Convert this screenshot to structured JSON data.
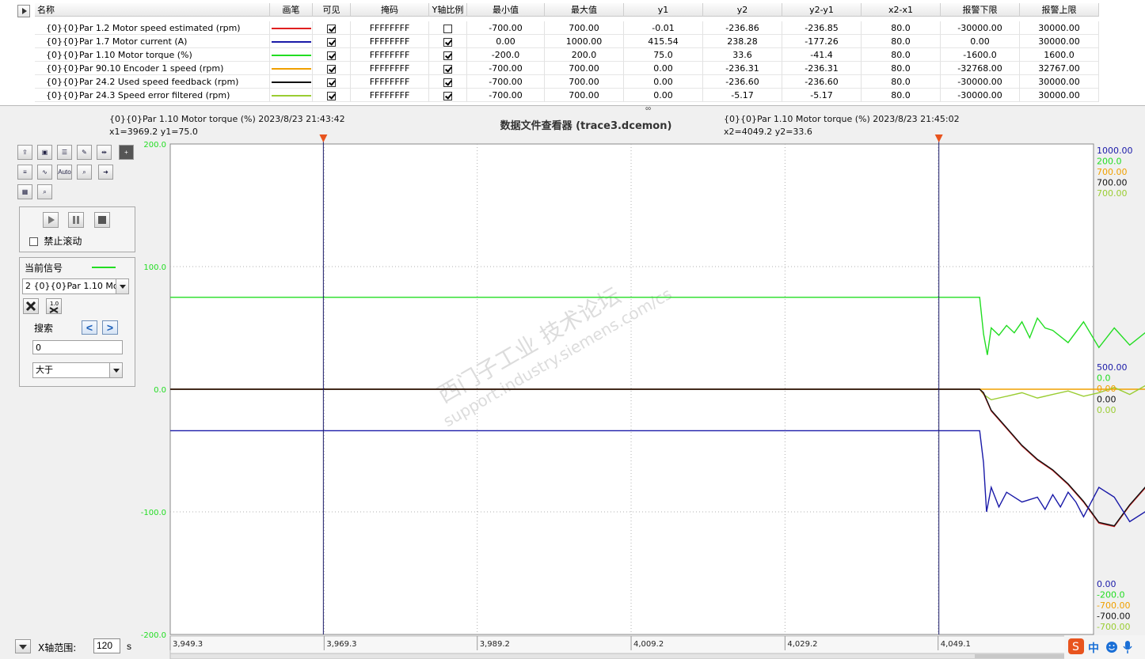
{
  "table": {
    "headers": [
      "名称",
      "画笔",
      "可见",
      "掩码",
      "Y轴比例",
      "最小值",
      "最大值",
      "y1",
      "y2",
      "y2-y1",
      "x2-x1",
      "报警下限",
      "报警上限"
    ],
    "rows": [
      {
        "name": "{0}{0}Par 1.2 Motor speed estimated (rpm)",
        "pen_color": "#e02020",
        "visible": true,
        "mask": "FFFFFFFF",
        "y_scale": false,
        "min": "-700.00",
        "max": "700.00",
        "y1": "-0.01",
        "y2": "-236.86",
        "dy": "-236.85",
        "dx": "80.0",
        "alarm_low": "-30000.00",
        "alarm_high": "30000.00"
      },
      {
        "name": "{0}{0}Par 1.7 Motor current (A)",
        "pen_color": "#1a1aa8",
        "visible": true,
        "mask": "FFFFFFFF",
        "y_scale": true,
        "min": "0.00",
        "max": "1000.00",
        "y1": "415.54",
        "y2": "238.28",
        "dy": "-177.26",
        "dx": "80.0",
        "alarm_low": "0.00",
        "alarm_high": "30000.00"
      },
      {
        "name": "{0}{0}Par 1.10 Motor torque (%)",
        "pen_color": "#22dd22",
        "visible": true,
        "mask": "FFFFFFFF",
        "y_scale": true,
        "min": "-200.0",
        "max": "200.0",
        "y1": "75.0",
        "y2": "33.6",
        "dy": "-41.4",
        "dx": "80.0",
        "alarm_low": "-1600.0",
        "alarm_high": "1600.0"
      },
      {
        "name": "{0}{0}Par 90.10 Encoder 1 speed (rpm)",
        "pen_color": "#f0a000",
        "visible": true,
        "mask": "FFFFFFFF",
        "y_scale": true,
        "min": "-700.00",
        "max": "700.00",
        "y1": "0.00",
        "y2": "-236.31",
        "dy": "-236.31",
        "dx": "80.0",
        "alarm_low": "-32768.00",
        "alarm_high": "32767.00"
      },
      {
        "name": "{0}{0}Par 24.2 Used speed feedback (rpm)",
        "pen_color": "#111111",
        "visible": true,
        "mask": "FFFFFFFF",
        "y_scale": true,
        "min": "-700.00",
        "max": "700.00",
        "y1": "0.00",
        "y2": "-236.60",
        "dy": "-236.60",
        "dx": "80.0",
        "alarm_low": "-30000.00",
        "alarm_high": "30000.00"
      },
      {
        "name": "{0}{0}Par 24.3 Speed error filtered (rpm)",
        "pen_color": "#9acd32",
        "visible": true,
        "mask": "FFFFFFFF",
        "y_scale": true,
        "min": "-700.00",
        "max": "700.00",
        "y1": "0.00",
        "y2": "-5.17",
        "dy": "-5.17",
        "dx": "80.0",
        "alarm_low": "-30000.00",
        "alarm_high": "30000.00"
      }
    ]
  },
  "cursor1": {
    "line1": "{0}{0}Par 1.10 Motor torque (%) 2023/8/23 21:43:42",
    "line2": "x1=3969.2 y1=75.0"
  },
  "cursor2": {
    "line1": "{0}{0}Par 1.10 Motor torque (%) 2023/8/23 21:45:02",
    "line2": "x2=4049.2 y2=33.6"
  },
  "title": "数据文件查看器 (trace3.dcemon)",
  "left_panel": {
    "toolbar_icons": [
      "open-file-icon",
      "save-icon",
      "table-icon",
      "wrench-icon",
      "cursor-icon",
      "add-icon",
      "list-icon",
      "wave-icon",
      "auto-scale-icon",
      "zoom-icon",
      "export-icon",
      "grid-icon",
      "zoom-y-icon"
    ],
    "auto_label": "Auto",
    "no_scroll_label": "禁止滚动",
    "current_signal_label": "当前信号",
    "current_signal_color": "#22dd22",
    "current_signal_value": "2 {0}{0}Par 1.10 Moto",
    "search_label": "搜索",
    "search_value": "0",
    "compare_value": "大于"
  },
  "x_range": {
    "label": "X轴范围:",
    "value": "120",
    "unit": "s"
  },
  "watermark": {
    "line1": "西门子工业 技术论坛",
    "line2": "support.industry.siemens.com/cs"
  },
  "ime": {
    "label": "中"
  },
  "chart_data": {
    "type": "line",
    "x_ticks": [
      "3,949.3",
      "3,969.3",
      "3,989.2",
      "4,009.2",
      "4,029.2",
      "4,049.1"
    ],
    "x_range": [
      3949.3,
      4069.3
    ],
    "cursor_x": [
      3969.2,
      4049.2
    ],
    "left_axis": {
      "ticks": [
        "200.0",
        "100.0",
        "0.0",
        "-100.0",
        "-200.0"
      ],
      "range": [
        -200,
        200
      ],
      "color": "#22dd22"
    },
    "right_axis": {
      "top_labels": [
        {
          "text": "1000.00",
          "color": "#1a1aa8"
        },
        {
          "text": "200.0",
          "color": "#22dd22"
        },
        {
          "text": "700.00",
          "color": "#f0a000"
        },
        {
          "text": "700.00",
          "color": "#111111"
        },
        {
          "text": "700.00",
          "color": "#9acd32"
        }
      ],
      "mid_labels": [
        {
          "text": "500.00",
          "color": "#1a1aa8"
        },
        {
          "text": "0.0",
          "color": "#22dd22"
        },
        {
          "text": "0.00",
          "color": "#f0a000"
        },
        {
          "text": "0.00",
          "color": "#111111"
        },
        {
          "text": "0.00",
          "color": "#9acd32"
        }
      ],
      "bottom_labels": [
        {
          "text": "0.00",
          "color": "#1a1aa8"
        },
        {
          "text": "-200.0",
          "color": "#22dd22"
        },
        {
          "text": "-700.00",
          "color": "#f0a000"
        },
        {
          "text": "-700.00",
          "color": "#111111"
        },
        {
          "text": "-700.00",
          "color": "#9acd32"
        }
      ]
    },
    "series": [
      {
        "name": "{0}{0}Par 1.7 Motor current (A)",
        "color": "#1a1aa8",
        "range": [
          0,
          1000
        ],
        "x": [
          3949.3,
          4054.5,
          4055.0,
          4055.4,
          4056.0,
          4057.0,
          4058.0,
          4060.0,
          4062.0,
          4063.0,
          4064.0,
          4065.0,
          4066.0,
          4067.0,
          4068.0,
          4070.0,
          4072.0,
          4074.0,
          4076.0,
          4078.0,
          4079.0,
          4080.0,
          4081.0,
          4082.0,
          4083.0,
          4084.0,
          4086.0,
          4088.0,
          4090.0,
          4092.0,
          4094.0,
          4096.0,
          4098.0,
          4100.0,
          4102.0,
          4104.0,
          4106.0,
          4108.0,
          4110.0,
          4112.0
        ],
        "y": [
          415.5,
          415.5,
          350,
          250,
          300,
          260,
          290,
          270,
          280,
          255,
          285,
          260,
          290,
          270,
          240,
          300,
          280,
          230,
          250,
          290,
          240,
          300,
          260,
          210,
          250,
          240,
          230,
          205,
          225,
          225,
          230,
          230,
          230,
          230,
          310,
          235,
          230,
          235,
          235,
          235
        ]
      },
      {
        "name": "{0}{0}Par 1.10 Motor torque (%)",
        "color": "#22dd22",
        "range": [
          -200,
          200
        ],
        "x": [
          3949.3,
          4054.5,
          4055.0,
          4055.5,
          4056.0,
          4057.0,
          4058.0,
          4059.0,
          4060.0,
          4061.0,
          4062.0,
          4063.0,
          4064.0,
          4066.0,
          4068.0,
          4070.0,
          4072.0,
          4074.0,
          4076.0,
          4078.0,
          4080.0,
          4082.0,
          4084.0,
          4086.0,
          4088.0,
          4090.0,
          4092.0,
          4094.0,
          4096.0,
          4098.0,
          4100.0,
          4102.0,
          4104.0,
          4106.0,
          4108.0,
          4110.0,
          4112.0
        ],
        "y": [
          75,
          75,
          45,
          28,
          50,
          44,
          52,
          46,
          55,
          42,
          58,
          50,
          48,
          38,
          55,
          34,
          50,
          36,
          46,
          40,
          60,
          35,
          34,
          36,
          40,
          55,
          33,
          36,
          43,
          42,
          43,
          45,
          30,
          28,
          29,
          28,
          28
        ]
      },
      {
        "name": "{0}{0}Par 24.2 Used speed feedback (rpm)",
        "color": "#111111",
        "range": [
          -700,
          700
        ],
        "x": [
          3949.3,
          4054.5,
          4055.0,
          4056.0,
          4058.0,
          4060.0,
          4062.0,
          4064.0,
          4066.0,
          4068.0,
          4070.0,
          4072.0,
          4074.0,
          4076.0,
          4078.0,
          4080.0,
          4082.0,
          4084.0,
          4086.0,
          4088.0,
          4090.0,
          4092.0,
          4094.0,
          4096.0,
          4098.0,
          4100.0,
          4102.0,
          4104.0,
          4106.0,
          4108.0,
          4110.0,
          4112.0
        ],
        "y": [
          0,
          0,
          -10,
          -60,
          -110,
          -160,
          -200,
          -230,
          -270,
          -320,
          -380,
          -390,
          -330,
          -280,
          -300,
          -330,
          -250,
          -20,
          -30,
          -160,
          -200,
          -220,
          -240,
          -235,
          -45,
          -10,
          -8,
          -8,
          -8,
          -8,
          -8,
          -8
        ]
      },
      {
        "name": "{0}{0}Par 1.2 Motor speed estimated (rpm)",
        "color": "#e02020",
        "range": [
          -700,
          700
        ],
        "x": [
          3949.3,
          4054.5,
          4055.0,
          4056.0,
          4058.0,
          4060.0,
          4062.0,
          4064.0,
          4066.0,
          4068.0,
          4070.0,
          4072.0,
          4074.0,
          4076.0,
          4078.0,
          4080.0,
          4082.0,
          4084.0,
          4086.0,
          4088.0,
          4090.0,
          4092.0,
          4094.0,
          4096.0,
          4098.0,
          4100.0,
          4102.0,
          4104.0,
          4106.0,
          4108.0,
          4110.0,
          4112.0
        ],
        "y": [
          0,
          0,
          -12,
          -62,
          -112,
          -162,
          -202,
          -232,
          -272,
          -322,
          -382,
          -392,
          -332,
          -282,
          -302,
          -332,
          -252,
          -22,
          -32,
          -162,
          -202,
          -222,
          -242,
          -237,
          -47,
          -12,
          -8,
          -8,
          -8,
          -8,
          -8,
          -8
        ]
      },
      {
        "name": "{0}{0}Par 24.3 Speed error filtered (rpm)",
        "color": "#9acd32",
        "range": [
          -700,
          700
        ],
        "x": [
          3949.3,
          4054.5,
          4055.0,
          4056.0,
          4058.0,
          4060.0,
          4062.0,
          4064.0,
          4066.0,
          4068.0,
          4070.0,
          4072.0,
          4074.0,
          4076.0,
          4078.0,
          4080.0,
          4082.0,
          4084.0,
          4086.0,
          4088.0,
          4090.0,
          4092.0,
          4094.0,
          4096.0,
          4098.0,
          4100.0,
          4104.0,
          4112.0
        ],
        "y": [
          0,
          0,
          -15,
          -30,
          -20,
          -10,
          -25,
          -15,
          -5,
          -20,
          -10,
          5,
          -15,
          10,
          -20,
          0,
          10,
          -20,
          -10,
          -15,
          0,
          -15,
          -5,
          -10,
          5,
          0,
          0,
          0
        ]
      },
      {
        "name": "{0}{0}Par 90.10 Encoder 1 speed (rpm)",
        "color": "#f0a000",
        "range": [
          -700,
          700
        ],
        "x": [
          3949.3,
          4112.0
        ],
        "y": [
          0,
          0
        ]
      }
    ]
  }
}
